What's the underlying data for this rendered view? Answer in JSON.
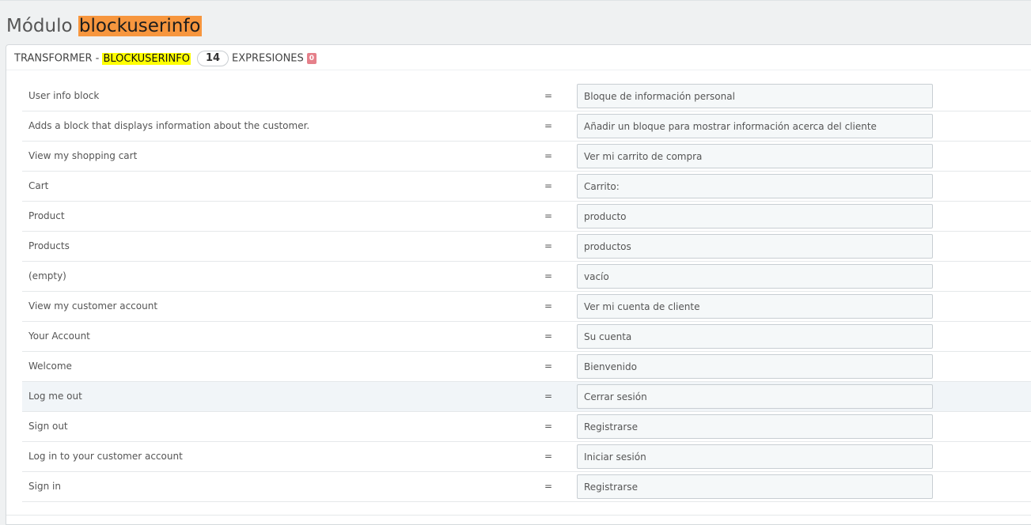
{
  "header": {
    "title_prefix": "Módulo",
    "module_name": "blockuserinfo"
  },
  "panel": {
    "heading_prefix": "TRANSFORMER - ",
    "heading_module": "BLOCKUSERINFO",
    "count": "14",
    "expressions_label": "EXPRESIONES",
    "expressions_count": "0"
  },
  "rows": [
    {
      "source": "User info block",
      "eq": "=",
      "translation": "Bloque de información personal"
    },
    {
      "source": "Adds a block that displays information about the customer.",
      "eq": "=",
      "translation": "Añadir un bloque para mostrar información acerca del cliente"
    },
    {
      "source": "View my shopping cart",
      "eq": "=",
      "translation": "Ver mi carrito de compra"
    },
    {
      "source": "Cart",
      "eq": "=",
      "translation": "Carrito:"
    },
    {
      "source": "Product",
      "eq": "=",
      "translation": "producto"
    },
    {
      "source": "Products",
      "eq": "=",
      "translation": "productos"
    },
    {
      "source": "(empty)",
      "eq": "=",
      "translation": "vacío"
    },
    {
      "source": "View my customer account",
      "eq": "=",
      "translation": "Ver mi cuenta de cliente"
    },
    {
      "source": "Your Account",
      "eq": "=",
      "translation": "Su cuenta"
    },
    {
      "source": "Welcome",
      "eq": "=",
      "translation": "Bienvenido"
    },
    {
      "source": "Log me out",
      "eq": "=",
      "translation": "Cerrar sesión"
    },
    {
      "source": "Sign out",
      "eq": "=",
      "translation": "Registrarse"
    },
    {
      "source": "Log in to your customer account",
      "eq": "=",
      "translation": "Iniciar sesión"
    },
    {
      "source": "Sign in",
      "eq": "=",
      "translation": "Registrarse"
    }
  ],
  "colors": {
    "title_highlight": "#f7963e",
    "heading_highlight": "#ffff00",
    "expressions_badge": "#e5808a",
    "hovered_row": "#f1f5f8"
  }
}
